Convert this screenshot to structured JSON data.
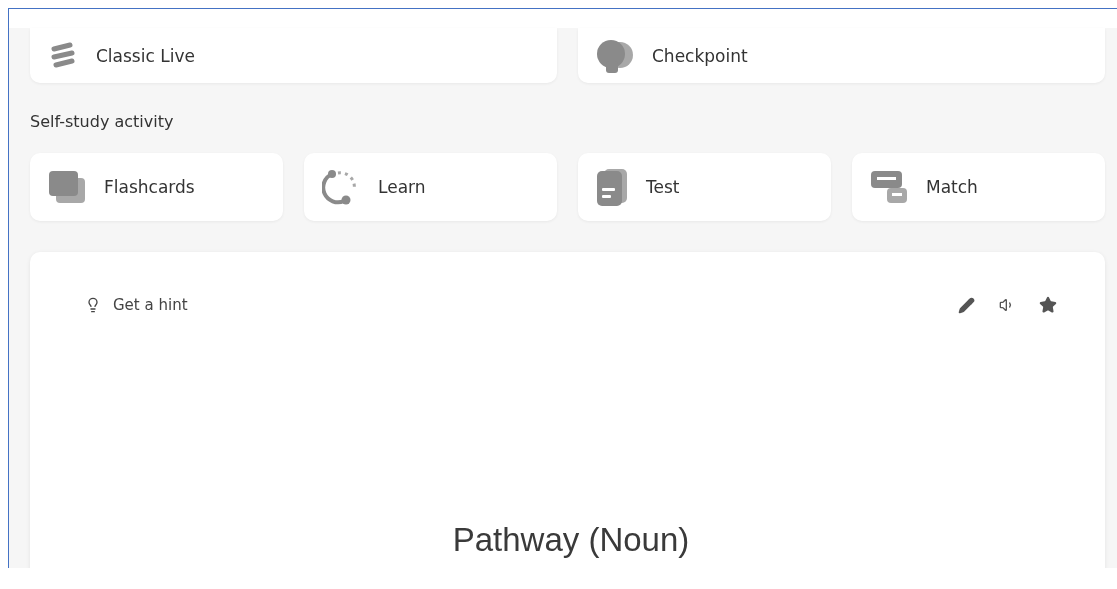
{
  "live_activities": [
    {
      "kind": "classic-live",
      "label": "Classic Live"
    },
    {
      "kind": "checkpoint",
      "label": "Checkpoint"
    }
  ],
  "self_study": {
    "heading": "Self-study activity",
    "activities": [
      {
        "kind": "flashcards",
        "label": "Flashcards"
      },
      {
        "kind": "learn",
        "label": "Learn"
      },
      {
        "kind": "test",
        "label": "Test"
      },
      {
        "kind": "match",
        "label": "Match"
      }
    ]
  },
  "flashcard": {
    "hint": "Get a hint",
    "term": "Pathway (Noun)"
  }
}
